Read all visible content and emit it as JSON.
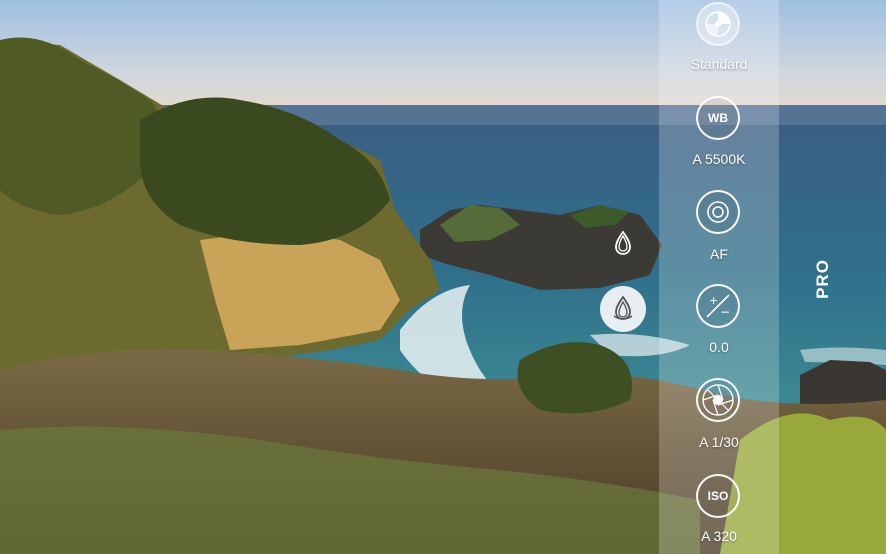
{
  "mode": {
    "label": "PRO"
  },
  "controls": {
    "color_profile": {
      "label": "Standard",
      "icon": "color-tone-icon"
    },
    "white_balance": {
      "icon_text": "WB",
      "value": "A 5500K"
    },
    "focus": {
      "icon": "focus-target-icon",
      "value": "AF"
    },
    "exposure": {
      "icon": "exposure-plus-minus-icon",
      "value": "0.0"
    },
    "shutter": {
      "icon": "shutter-aperture-icon",
      "value": "A 1/30"
    },
    "iso": {
      "icon_text": "ISO",
      "value": "A 320"
    }
  },
  "focus_markers": {
    "small_icon": "droplet-focus-icon",
    "large_icon": "droplet-exposure-icon"
  },
  "colors": {
    "panel": "rgba(255,255,255,0.22)",
    "text": "#ffffff"
  }
}
